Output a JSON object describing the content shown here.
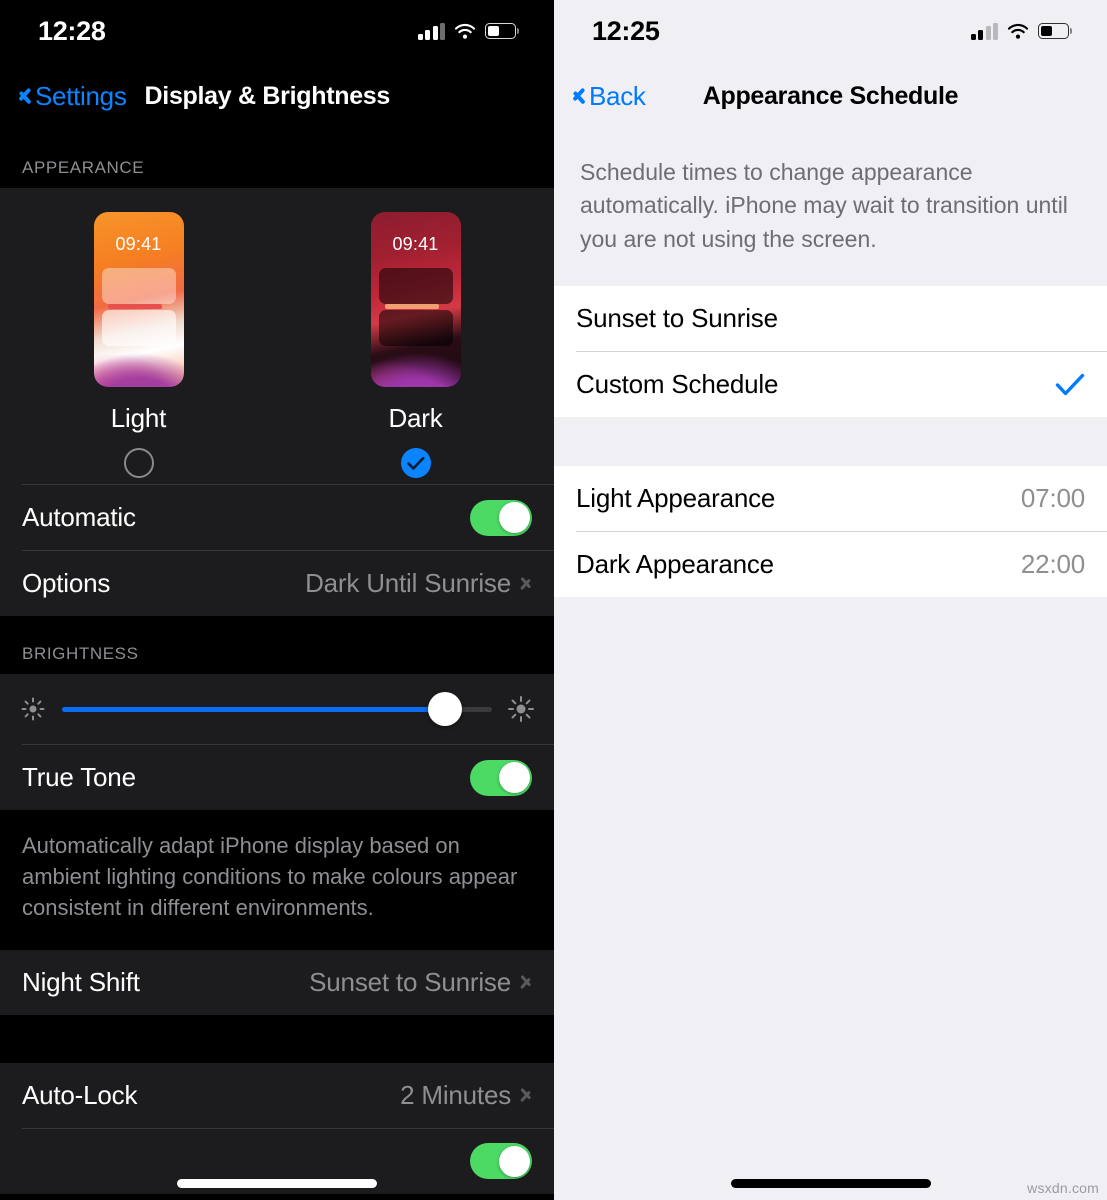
{
  "left": {
    "status": {
      "time": "12:28",
      "icons": [
        "cellular-signal-icon",
        "wifi-icon",
        "battery-icon"
      ]
    },
    "nav": {
      "back_label": "Settings",
      "title": "Display & Brightness"
    },
    "appearance": {
      "section_header": "APPEARANCE",
      "options": [
        {
          "label": "Light",
          "preview_time": "09:41",
          "selected": false
        },
        {
          "label": "Dark",
          "preview_time": "09:41",
          "selected": true
        }
      ],
      "rows": [
        {
          "label": "Automatic",
          "control": "toggle",
          "value": "on"
        },
        {
          "label": "Options",
          "value": "Dark Until Sunrise",
          "control": "disclosure"
        }
      ]
    },
    "brightness": {
      "section_header": "BRIGHTNESS",
      "slider_percent": 89,
      "rows": [
        {
          "label": "True Tone",
          "control": "toggle",
          "value": "on"
        }
      ],
      "note": "Automatically adapt iPhone display based on ambient lighting conditions to make colours appear consistent in different environments."
    },
    "night_shift": {
      "label": "Night Shift",
      "value": "Sunset to Sunrise"
    },
    "auto_lock": {
      "label": "Auto-Lock",
      "value": "2 Minutes"
    }
  },
  "right": {
    "status": {
      "time": "12:25",
      "icons": [
        "cellular-signal-icon",
        "wifi-icon",
        "battery-icon"
      ]
    },
    "nav": {
      "back_label": "Back",
      "title": "Appearance Schedule"
    },
    "note": "Schedule times to change appearance automatically. iPhone may wait to transition until you are not using the screen.",
    "schedule_options": [
      {
        "label": "Sunset to Sunrise",
        "selected": false
      },
      {
        "label": "Custom Schedule",
        "selected": true
      }
    ],
    "times": [
      {
        "label": "Light Appearance",
        "value": "07:00"
      },
      {
        "label": "Dark Appearance",
        "value": "22:00"
      }
    ]
  },
  "watermark": "wsxdn.com",
  "colors": {
    "accent_blue": "#0a84ff",
    "toggle_green": "#4cd964",
    "slider_blue": "#0a6cf1",
    "dark_group_bg": "#1c1c1e",
    "dark_bg": "#000000",
    "light_group_bg": "#ffffff",
    "light_bg": "#efeff4",
    "secondary_text": "#8e8e93"
  }
}
